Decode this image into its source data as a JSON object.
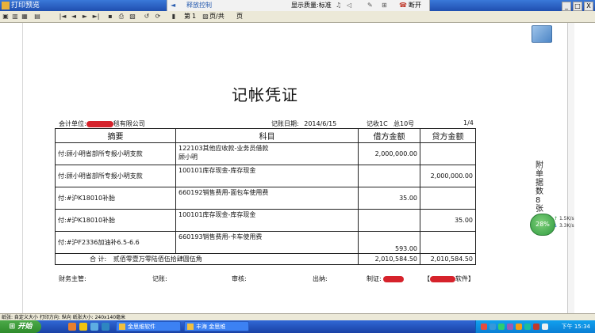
{
  "window": {
    "title": "打印预览",
    "center": {
      "nav_label": "释放控制",
      "quality": "显示质量:标准",
      "disconnect": "断开"
    },
    "buttons": [
      "_",
      "□",
      "X"
    ]
  },
  "toolbar": {
    "page_prefix": "第",
    "page_current": "1",
    "page_suffix": "页/共",
    "page_total": "页"
  },
  "voucher": {
    "title": "记帐凭证",
    "unit_label": "会计单位:",
    "unit_suffix": "毯有限公司",
    "date_label": "记账日期:",
    "date": "2014/6/15",
    "voucher_type": "记收1C",
    "voucher_no": "总10号",
    "page": "1/4",
    "headers": [
      "摘要",
      "科目",
      "借方金额",
      "贷方金额"
    ],
    "rows": [
      {
        "summary": "付:顾小明省部所专报小明支款",
        "account": "122103其他应收款-业务员借款\n顾小明",
        "debit": "2,000,000.00",
        "credit": ""
      },
      {
        "summary": "付:顾小明省部所专报小明支款",
        "account": "100101库存现金-库存现金",
        "debit": "",
        "credit": "2,000,000.00"
      },
      {
        "summary": "付:#沪K18010补胎",
        "account": "660192销售费用-面包车使用费",
        "debit": "35.00",
        "credit": ""
      },
      {
        "summary": "付:#沪K18010补胎",
        "account": "100101库存现金-库存现金",
        "debit": "",
        "credit": "35.00"
      },
      {
        "summary": "付:#沪F2336加油补6.5-6.6",
        "account": "660193销售费用-卡车使用费",
        "debit": "593.00",
        "credit": ""
      }
    ],
    "total_label": "合    计:",
    "total_words": "贰佰零壹万零陆佰伍拾肆圆伍角",
    "total_debit": "2,010,584.50",
    "total_credit": "2,010,584.50",
    "footer": {
      "supervisor": "财务主管:",
      "bookkeeper": "记账:",
      "auditor": "审核:",
      "cashier": "出纳:",
      "maker": "制证:",
      "software_suffix": "软件】"
    }
  },
  "side": {
    "attachment_note": "附单据数8张",
    "speed_percent": "28%",
    "up_rate": "1.5K/s",
    "down_rate": "3.3K/s"
  },
  "statusbar": {
    "text": "纸张: 自定义大小  打印方向: 纵向  纸张大小: 240x140毫米"
  },
  "taskbar": {
    "start": "开始",
    "tasks": [
      "金思维软件",
      "丰海 金思维"
    ],
    "clock": "下午 15:34"
  },
  "colors": {
    "redaction": "#d6222b",
    "titlebar": "#1f4fb0",
    "taskbar": "#1941a5"
  }
}
